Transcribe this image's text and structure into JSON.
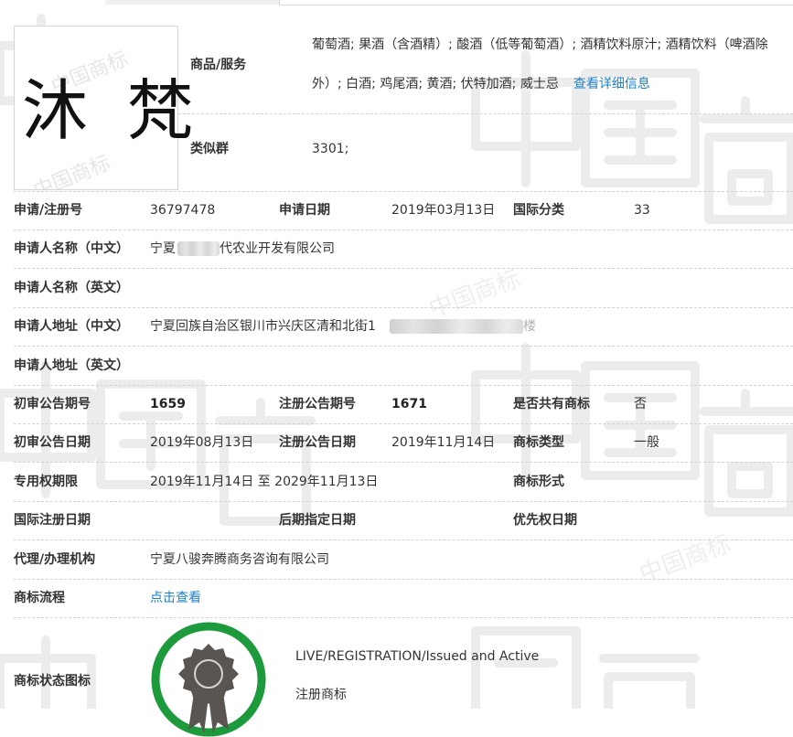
{
  "colors": {
    "link": "#1e7fc6",
    "badge_ring": "#1d9a3c",
    "badge_medal": "#5a5550",
    "dashed_rule": "#d2d2d2",
    "watermark": "#f0f0f0"
  },
  "watermark": {
    "text": "中国商标"
  },
  "trademark": {
    "mark_text": "沐 梵"
  },
  "goods": {
    "label": "商品/服务",
    "line1": "葡萄酒; 果酒（含酒精）; 酸酒（低等葡萄酒）; 酒精饮料原汁; 酒精饮料（啤酒除",
    "line2": "外）; 白酒; 鸡尾酒; 黄酒; 伏特加酒; 威士忌",
    "detail_link": "查看详细信息"
  },
  "similar_group": {
    "label": "类似群",
    "value": "3301;"
  },
  "fields": {
    "reg_no": {
      "label": "申请/注册号",
      "value": "36797478"
    },
    "app_date": {
      "label": "申请日期",
      "value": "2019年03月13日"
    },
    "intl_class": {
      "label": "国际分类",
      "value": "33"
    },
    "applicant_cn": {
      "label": "申请人名称（中文）",
      "value_prefix": "宁夏",
      "value_suffix": "代农业开发有限公司"
    },
    "applicant_en": {
      "label": "申请人名称（英文）",
      "value": ""
    },
    "address_cn": {
      "label": "申请人地址（中文）",
      "value_prefix": "宁夏回族自治区银川市兴庆区清和北街1",
      "value_suffix": "楼"
    },
    "address_en": {
      "label": "申请人地址（英文）",
      "value": ""
    },
    "prelim_no": {
      "label": "初审公告期号",
      "value": "1659"
    },
    "reg_pub_no": {
      "label": "注册公告期号",
      "value": "1671"
    },
    "shared": {
      "label": "是否共有商标",
      "value": "否"
    },
    "prelim_date": {
      "label": "初审公告日期",
      "value": "2019年08月13日"
    },
    "reg_pub_date": {
      "label": "注册公告日期",
      "value": "2019年11月14日"
    },
    "tm_type": {
      "label": "商标类型",
      "value": "一般"
    },
    "exclusive_period": {
      "label": "专用权期限",
      "value": "2019年11月14日 至 2029年11月13日"
    },
    "tm_form": {
      "label": "商标形式",
      "value": ""
    },
    "intl_reg_date": {
      "label": "国际注册日期",
      "value": ""
    },
    "later_designation": {
      "label": "后期指定日期",
      "value": ""
    },
    "priority_date": {
      "label": "优先权日期",
      "value": ""
    },
    "agent": {
      "label": "代理/办理机构",
      "value": "宁夏八骏奔腾商务咨询有限公司"
    },
    "process": {
      "label": "商标流程",
      "link": "点击查看"
    }
  },
  "status": {
    "label": "商标状态图标",
    "english": "LIVE/REGISTRATION/Issued and Active",
    "chinese": "注册商标"
  }
}
